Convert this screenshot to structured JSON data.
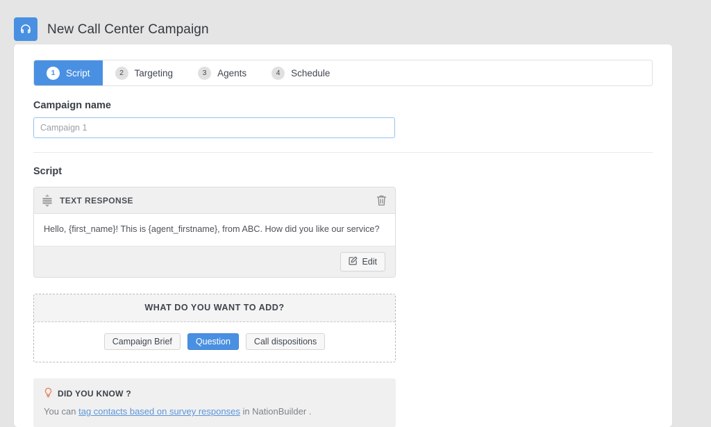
{
  "header": {
    "icon": "headset-icon",
    "title": "New Call Center Campaign"
  },
  "tabs": [
    {
      "num": "1",
      "label": "Script",
      "active": true
    },
    {
      "num": "2",
      "label": "Targeting",
      "active": false
    },
    {
      "num": "3",
      "label": "Agents",
      "active": false
    },
    {
      "num": "4",
      "label": "Schedule",
      "active": false
    }
  ],
  "campaign_name": {
    "label": "Campaign name",
    "value": "Campaign 1",
    "placeholder": "Campaign 1"
  },
  "script": {
    "section_title": "Script",
    "block": {
      "drag_icon": "drag-handle-icon",
      "type_label": "TEXT RESPONSE",
      "delete_icon": "trash-icon",
      "text": "Hello, {first_name}! This is {agent_firstname}, from ABC. How did you like our service?",
      "edit_label": "Edit",
      "edit_icon": "pencil-square-icon"
    }
  },
  "add_panel": {
    "title": "WHAT DO YOU WANT TO ADD?",
    "buttons": [
      {
        "label": "Campaign Brief",
        "active": false
      },
      {
        "label": "Question",
        "active": true
      },
      {
        "label": "Call dispositions",
        "active": false
      }
    ]
  },
  "did_you_know": {
    "icon": "lightbulb-icon",
    "title": "DID YOU KNOW ?",
    "text_before": "You can ",
    "link_text": "tag contacts based on survey responses",
    "text_after": " in NationBuilder ."
  },
  "colors": {
    "accent_blue": "#4a90e2",
    "page_background": "#e5e5e5",
    "card_background": "#ffffff",
    "panel_gray": "#f0f0f0",
    "lightbulb_orange": "#e8805a"
  }
}
